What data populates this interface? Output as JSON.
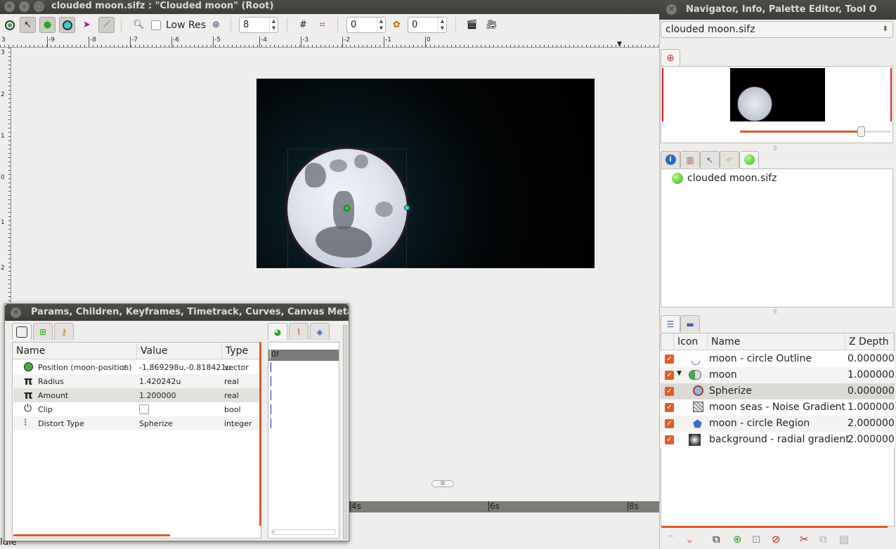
{
  "main_window": {
    "title": "clouded moon.sifz : \"Clouded moon\" (Root)",
    "toolbar": {
      "low_res_label": "Low Res",
      "quality_value": "8",
      "past_onion_value": "0",
      "future_onion_value": "0"
    },
    "ruler_ticks": [
      "-9",
      "-8",
      "-7",
      "-6",
      "-5",
      "-4",
      "-3",
      "-2",
      "-1",
      "0"
    ],
    "ruler_v_ticks": [
      "3",
      "2",
      "1",
      "0",
      "1",
      "2"
    ],
    "timebar_ticks": [
      "4s",
      "6s",
      "8s"
    ],
    "status_text": "Idle"
  },
  "params_panel": {
    "title": "Params, Children, Keyframes, Timetrack, Curves, Canvas MetaD",
    "columns": [
      "Name",
      "Value",
      "Type"
    ],
    "rows": [
      {
        "name": "Position (moon-position)",
        "value": "-1.869298u,-0.818421u",
        "type": "vector",
        "icon": "circle-dot-icon"
      },
      {
        "name": "Radius",
        "value": "1.420242u",
        "type": "real",
        "icon": "pi-icon"
      },
      {
        "name": "Amount",
        "value": "1.200000",
        "type": "real",
        "icon": "pi-icon"
      },
      {
        "name": "Clip",
        "value": "",
        "type": "bool",
        "icon": "power-icon"
      },
      {
        "name": "Distort Type",
        "value": "Spherize",
        "type": "integer",
        "icon": "dots-icon"
      }
    ],
    "timetrack_label": "0f"
  },
  "right_panel": {
    "title": "Navigator, Info, Palette Editor, Tool O",
    "file_selector": "clouded moon.sifz",
    "canvas_browser_item": "clouded moon.sifz",
    "navigator_zoom_fraction": 0.8
  },
  "layers_panel": {
    "columns": [
      "Icon",
      "Name",
      "Z Depth"
    ],
    "rows": [
      {
        "name": "moon - circle Outline",
        "z": "0.000000",
        "indent": 0,
        "icon": "outline-icon"
      },
      {
        "name": "moon",
        "z": "1.000000",
        "indent": 0,
        "icon": "group-icon",
        "expanded": true
      },
      {
        "name": "Spherize",
        "z": "0.000000",
        "indent": 1,
        "icon": "spherize-icon"
      },
      {
        "name": "moon seas - Noise Gradient",
        "z": "1.000000",
        "indent": 1,
        "icon": "noise-icon"
      },
      {
        "name": "moon - circle Region",
        "z": "2.000000",
        "indent": 1,
        "icon": "region-icon"
      },
      {
        "name": "background - radial gradient",
        "z": "2.000000",
        "indent": 0,
        "icon": "radial-gradient-icon"
      }
    ]
  },
  "colors": {
    "accent": "#e05a2b",
    "titlebar": "#3f3e3a",
    "canvas_bg": "#020607"
  }
}
